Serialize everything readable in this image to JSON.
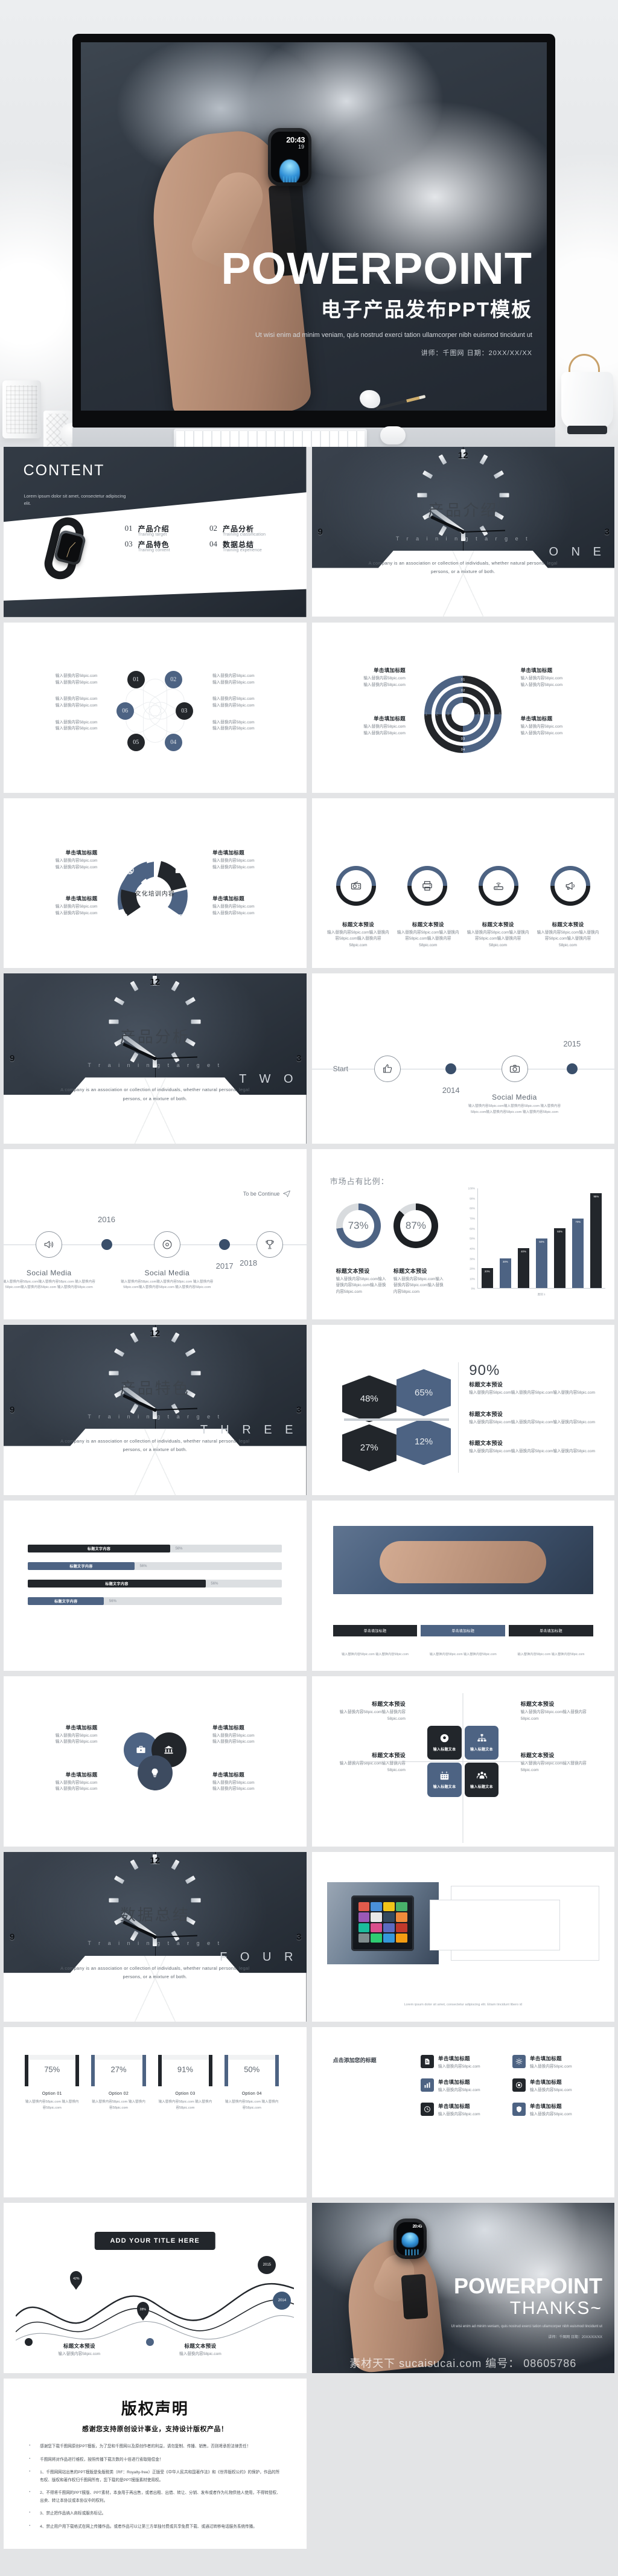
{
  "hero": {
    "title": "POWERPOINT",
    "subtitle_cn": "电子产品发布PPT模板",
    "desc": "Ut wisi enim ad minim veniam, quis nostrud exerci tation ullamcorper nibh euismod tincidunt ut",
    "meta": "讲师：千图网  日期：20XX/XX/XX",
    "watch_time": "20:43",
    "watch_sub": "19"
  },
  "content": {
    "heading": "CONTENT",
    "sub": "Lorem ipsum dolor sit amet, consectetur adipiscing elit.",
    "items": [
      {
        "num": "01",
        "title": "产品介绍",
        "sub": "Training target"
      },
      {
        "num": "02",
        "title": "产品分析",
        "sub": "Training classification"
      },
      {
        "num": "03",
        "title": "产品特色",
        "sub": "Training content"
      },
      {
        "num": "04",
        "title": "数据总结",
        "sub": "Training experience"
      }
    ]
  },
  "dividers": [
    {
      "num": "O N E",
      "title": "产品介绍",
      "sub": "T r a i n i n g   t a r g e t",
      "desc": "A company is an association or collection of individuals, whether natural persons, legal persons, or a mixture of both."
    },
    {
      "num": "T W O",
      "title": "产品分析",
      "sub": "T r a i n i n g   t a r g e t",
      "desc": "A company is an association or collection of individuals, whether natural persons, legal persons, or a mixture of both."
    },
    {
      "num": "T H R E E",
      "title": "产品特色",
      "sub": "T r a i n i n g   t a r g e t",
      "desc": "A company is an association or collection of individuals, whether natural persons, legal persons, or a mixture of both."
    },
    {
      "num": "F O U R",
      "title": "数据总结",
      "sub": "T r a i n i n g   t a r g e t",
      "desc": "A company is an association or collection of individuals, whether natural persons, legal persons, or a mixture of both."
    }
  ],
  "common": {
    "title_label": "单击填加标题",
    "body_line": "输入替换内容58pic.com",
    "preset_title": "标题文本预设",
    "preset_body": "输入替换内容58pic.com输入替换内容58pic.com输入替换内容58pic.com",
    "input_title": "输入标题文本",
    "bar_label": "标题文字内容",
    "center_label": "文化培训内容"
  },
  "petals": {
    "numbers": [
      "01",
      "02",
      "03",
      "04",
      "05",
      "06"
    ]
  },
  "rings": {
    "labels": [
      "01",
      "02",
      "03",
      "04"
    ],
    "scale": [
      "1",
      "2",
      "3",
      "4",
      "5",
      "6"
    ]
  },
  "timeline1": {
    "start": "Start",
    "years": [
      "2014",
      "2015"
    ],
    "caption_title": "Social Media",
    "caption_body": "输入替换内容58pic.com输入替换内容58pic.com 输入替换内容58pic.com输入替换内容58pic.com 输入替换内容58pic.com"
  },
  "timeline2": {
    "years": [
      "2016",
      "2017",
      "2018"
    ],
    "end": "To be Continue",
    "caption_title": "Social Media"
  },
  "chart_data": {
    "type": "bar",
    "title": "市场占有比例：",
    "categories": [
      "1",
      "2",
      "3",
      "4",
      "5",
      "6",
      "7"
    ],
    "values": [
      20,
      30,
      40,
      50,
      60,
      70,
      95
    ],
    "data_labels": [
      "20%",
      "30%",
      "40%",
      "50%",
      "60%",
      "70%",
      "95%"
    ],
    "colors": [
      "#22262b",
      "#4d6383",
      "#22262b",
      "#4d6383",
      "#22262b",
      "#4d6383",
      "#22262b"
    ],
    "ylabel": "",
    "xlabel": "类别 1",
    "ylim": [
      0,
      100
    ],
    "yticks": [
      "100%",
      "90%",
      "80%",
      "70%",
      "60%",
      "50%",
      "40%",
      "30%",
      "20%",
      "10%",
      "0%"
    ],
    "grid": false,
    "donuts": [
      {
        "value": 73,
        "label": "73%",
        "title": "标题文本预设",
        "color": "#4d6383"
      },
      {
        "value": 87,
        "label": "87%",
        "title": "标题文本预设",
        "color": "#1d2024"
      }
    ],
    "donut_body": "输入替换内容58pic.com输入替换内容58pic.com输入替换内容58pic.com"
  },
  "hexagons": {
    "values": [
      "48%",
      "65%",
      "27%",
      "12%"
    ],
    "headline": "90%",
    "rows": [
      {
        "title": "标题文本预设",
        "body": "输入替换内容58pic.com输入替换内容58pic.com输入替换内容58pic.com"
      },
      {
        "title": "标题文本预设",
        "body": "输入替换内容58pic.com输入替换内容58pic.com输入替换内容58pic.com"
      },
      {
        "title": "标题文本预设",
        "body": "输入替换内容58pic.com输入替换内容58pic.com输入替换内容58pic.com"
      }
    ]
  },
  "progress": {
    "bars": [
      {
        "label": "标题文字内容",
        "pct": "56%",
        "fill": 56,
        "color": "#22262b"
      },
      {
        "label": "标题文字内容",
        "pct": "56%",
        "fill": 42,
        "color": "#4d6383"
      },
      {
        "label": "标题文字内容",
        "pct": "56%",
        "fill": 70,
        "color": "#22262b"
      },
      {
        "label": "标题文字内容",
        "pct": "56%",
        "fill": 30,
        "color": "#4d6383"
      }
    ]
  },
  "tags": {
    "items": [
      "单击填加标题",
      "单击填加标题",
      "单击填加标题"
    ],
    "body": "输入替换内容58pic.com 输入替换内容58pic.com"
  },
  "options": {
    "percents": [
      "75%",
      "27%",
      "91%",
      "50%"
    ],
    "labels": [
      "Option 01",
      "Option 02",
      "Option 03",
      "Option 04"
    ],
    "body": "输入替换内容58pic.com 输入替换内容58pic.com",
    "caption": "Lorem ipsum dolor sit amet, consectetur adipiscing elit. Etiam tincidunt libero id"
  },
  "wave": {
    "button": "ADD YOUR TITLE HERE",
    "pins": [
      "42%",
      "28%"
    ],
    "years": [
      "2015",
      "2014"
    ],
    "footer_title": "标题文本预设",
    "footer_body": "输入替换内容58pic.com"
  },
  "icongrid": {
    "lead": "点击添加您的标题",
    "items": [
      {
        "title": "标题文本预设",
        "body": "输入替换内容58pic.com输入替换内容58pic.com"
      },
      {
        "title": "标题文本预设",
        "body": "输入替换内容58pic.com输入替换内容58pic.com"
      },
      {
        "title": "标题文本预设",
        "body": "输入替换内容58pic.com输入替换内容58pic.com"
      },
      {
        "title": "标题文本预设",
        "body": "输入替换内容58pic.com输入替换内容58pic.com"
      }
    ]
  },
  "thanks": {
    "title": "POWERPOINT",
    "sub": "THANKS~",
    "desc": "Ut wisi enim ad minim veniam, quis nostrud exerci tation ullamcorper nibh euismod tincidunt ut",
    "meta": "讲师：千图网  日期：20XX/XX/XX",
    "watermark": "素材天下 sucaisucai.com  编号： 08605786"
  },
  "copyright": {
    "title": "版权声明",
    "subtitle": "感谢您支持原创设计事业，支持设计版权产品！",
    "items": [
      "感谢您下载千图网原创PPT模板，为了您和千图网以及原创作者的利益，请勿复制、传播、销售，否则将承担法律责任！",
      "千图网将对作品进行维权，按照传播下载次数的十倍进行索取赔偿金！",
      "1、千图网网站出售的PPT模版是免版税类（RF：Royalty-free）正版受《中华人民共和国著作法》和《世界版权公约》的保护，作品的所有权、版权和著作权归千图网所有，您下载的是PPT模版素材使用权。",
      "2、不得将千图网的PPT模版、PPT素材，本身用于再出售，或者出租、出借、转让、分销、发布或者作为礼物供他人使用，不得转授权、出卖、转让本协议或本协议中的权利。",
      "3、禁止把作品纳入商标或服务标记。",
      "4、禁止用户用下载格式在网上传播作品。或者作品可以让第三方单独付费或共享免费下载、或通过转移电话服务系统传播。"
    ]
  }
}
